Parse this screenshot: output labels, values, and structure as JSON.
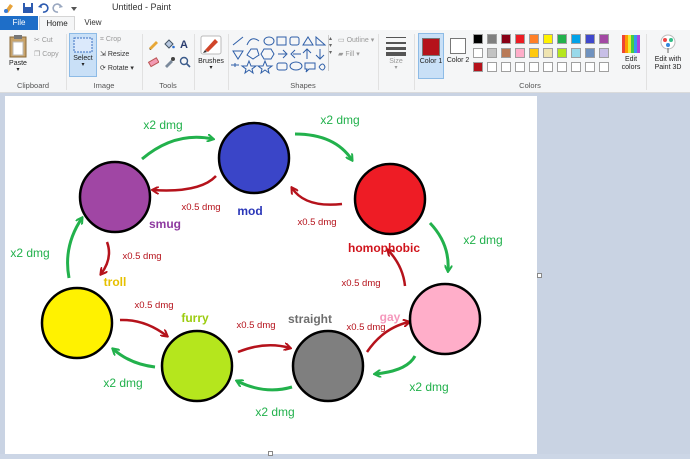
{
  "window": {
    "title": "Untitled - Paint"
  },
  "tabs": {
    "file": "File",
    "home": "Home",
    "view": "View"
  },
  "ribbon": {
    "clipboard": {
      "paste": "Paste",
      "cut": "Cut",
      "copy": "Copy",
      "label": "Clipboard"
    },
    "image": {
      "select": "Select",
      "crop": "Crop",
      "resize": "Resize",
      "rotate": "Rotate",
      "label": "Image"
    },
    "tools": {
      "label": "Tools"
    },
    "brushes": {
      "label": "Brushes"
    },
    "shapes": {
      "outline": "Outline",
      "fill": "Fill",
      "label": "Shapes"
    },
    "size": {
      "label": "Size"
    },
    "colors": {
      "color1": "Color 1",
      "color2": "Color 2",
      "edit_colors": "Edit colors",
      "edit_paint3d": "Edit with Paint 3D",
      "label": "Colors",
      "color1_value": "#b5121b",
      "color2_value": "#ffffff",
      "palette_row1": [
        "#000000",
        "#7f7f7f",
        "#880015",
        "#ed1c24",
        "#ff7f27",
        "#fff200",
        "#22b14c",
        "#00a2e8",
        "#3f48cc",
        "#a349a4"
      ],
      "palette_row2": [
        "#ffffff",
        "#c3c3c3",
        "#b97a57",
        "#ffaec9",
        "#ffc90e",
        "#efe4b0",
        "#b5e61d",
        "#99d9ea",
        "#7092be",
        "#c8bfe7"
      ],
      "palette_row3": [
        "#b5121b",
        "#ffffff",
        "#ffffff",
        "#ffffff",
        "#ffffff",
        "#ffffff",
        "#ffffff",
        "#ffffff",
        "#ffffff",
        "#ffffff"
      ]
    }
  },
  "diagram": {
    "nodes": [
      {
        "id": "mod",
        "label": "mod",
        "fill": "#3a45c8",
        "label_color": "#2a36b8"
      },
      {
        "id": "smug",
        "label": "smug",
        "fill": "#a046a4",
        "label_color": "#8e3aa0"
      },
      {
        "id": "homophobic",
        "label": "homophobic",
        "fill": "#ee1c25",
        "label_color": "#d0141c"
      },
      {
        "id": "troll",
        "label": "troll",
        "fill": "#fff200",
        "label_color": "#e6c000"
      },
      {
        "id": "gay",
        "label": "gay",
        "fill": "#ffaec9",
        "label_color": "#f598bc"
      },
      {
        "id": "furry",
        "label": "furry",
        "fill": "#b5e61d",
        "label_color": "#9ccc10"
      },
      {
        "id": "straight",
        "label": "straight",
        "fill": "#7f7f7f",
        "label_color": "#6e6e6e"
      }
    ],
    "strong_label": "x2 dmg",
    "weak_label": "x0.5 dmg",
    "strong_color": "#22b14c",
    "weak_color": "#b5121b"
  }
}
